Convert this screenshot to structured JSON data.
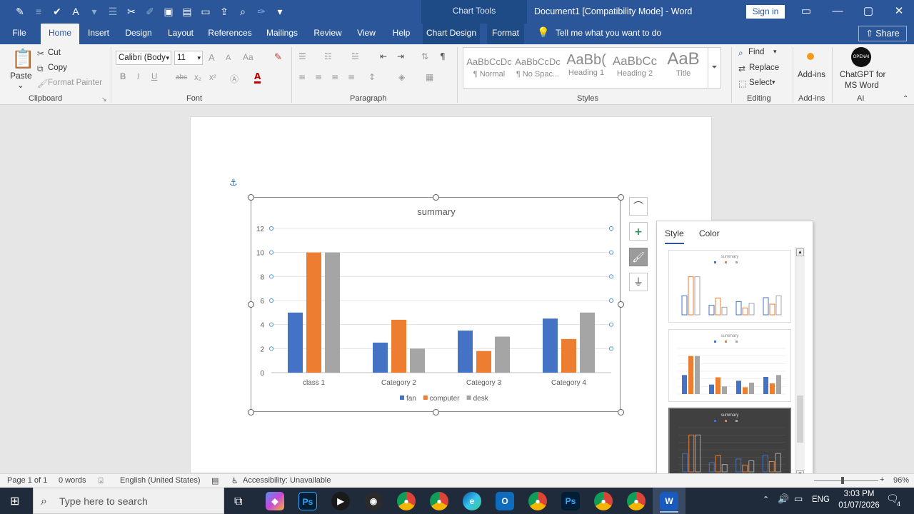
{
  "titlebar": {
    "context_title": "Chart Tools",
    "doc_title": "Document1 [Compatibility Mode]  -  Word",
    "signin": "Sign in",
    "minimize": "—",
    "restore": "▢",
    "close": "✕",
    "display_options": "▭"
  },
  "tabs": [
    "File",
    "Home",
    "Insert",
    "Design",
    "Layout",
    "References",
    "Mailings",
    "Review",
    "View",
    "Help",
    "Chart Design",
    "Format"
  ],
  "tellme": "Tell me what you want to do",
  "share": "Share",
  "ribbon": {
    "clipboard": {
      "paste": "Paste",
      "cut": "Cut",
      "copy": "Copy",
      "format_painter": "Format Painter",
      "label": "Clipboard"
    },
    "font": {
      "font_name": "Calibri (Body",
      "font_size": "11",
      "label": "Font",
      "bold": "B",
      "italic": "I",
      "underline": "U",
      "strike": "abc",
      "sub": "x₂",
      "sup": "x²",
      "grow": "A",
      "shrink": "A",
      "case": "Aa"
    },
    "paragraph": {
      "label": "Paragraph"
    },
    "styles": {
      "label": "Styles",
      "items": [
        {
          "preview": "AaBbCcDc",
          "name": "¶ Normal"
        },
        {
          "preview": "AaBbCcDc",
          "name": "¶ No Spac..."
        },
        {
          "preview": "AaBb(",
          "name": "Heading 1"
        },
        {
          "preview": "AaBbCc",
          "name": "Heading 2"
        },
        {
          "preview": "AaB",
          "name": "Title"
        }
      ]
    },
    "editing": {
      "find": "Find",
      "replace": "Replace",
      "select": "Select",
      "label": "Editing"
    },
    "addins": {
      "addins": "Add-ins",
      "label": "Add-ins"
    },
    "ai": {
      "name1": "ChatGPT for",
      "name2": "MS Word",
      "label": "AI",
      "logo": "OPENAI"
    }
  },
  "chart_data": {
    "type": "bar",
    "title": "summary",
    "categories": [
      "class 1",
      "Category 2",
      "Category 3",
      "Category 4"
    ],
    "series": [
      {
        "name": "fan",
        "values": [
          5,
          2.5,
          3.5,
          4.5
        ],
        "color": "#4472c4"
      },
      {
        "name": "computer",
        "values": [
          10,
          4.4,
          1.8,
          2.8
        ],
        "color": "#ed7d31"
      },
      {
        "name": "desk",
        "values": [
          10,
          2,
          3,
          5
        ],
        "color": "#a5a5a5"
      }
    ],
    "ylim": [
      0,
      12
    ],
    "yticks": [
      "0",
      "2",
      "4",
      "6",
      "8",
      "10",
      "12"
    ],
    "grid": true,
    "legend": "bottom"
  },
  "pane": {
    "tab_style": "Style",
    "tab_color": "Color",
    "thumb_title": "summary"
  },
  "status": {
    "page": "Page 1 of 1",
    "words": "0 words",
    "language": "English (United States)",
    "accessibility": "Accessibility: Unavailable",
    "zoom": "96%"
  },
  "taskbar": {
    "search_placeholder": "Type here to search",
    "time": "3:03 PM",
    "date": "01/07/2026",
    "lang": "ENG",
    "notif_count": "4"
  }
}
